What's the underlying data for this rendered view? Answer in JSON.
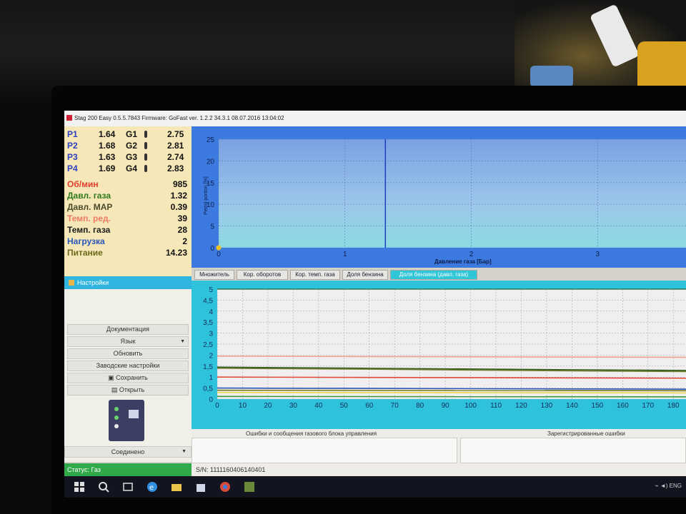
{
  "window": {
    "title": "Stag 200 Easy 0.5.5.7843 Firmware: GoFast  ver. 1.2.2  34.3.1   08.07.2016 13:04:02"
  },
  "injectors": [
    {
      "p_label": "P1",
      "p_value": "1.64",
      "g_label": "G1",
      "g_value": "2.75"
    },
    {
      "p_label": "P2",
      "p_value": "1.68",
      "g_label": "G2",
      "g_value": "2.81"
    },
    {
      "p_label": "P3",
      "p_value": "1.63",
      "g_label": "G3",
      "g_value": "2.74"
    },
    {
      "p_label": "P4",
      "p_value": "1.69",
      "g_label": "G4",
      "g_value": "2.83"
    }
  ],
  "sensors": [
    {
      "label": "Об/мин",
      "value": "985",
      "color": "#e23b2a"
    },
    {
      "label": "Давл. газа",
      "value": "1.32",
      "color": "#2f7a1e"
    },
    {
      "label": "Давл. MAP",
      "value": "0.39",
      "color": "#4a4a2a"
    },
    {
      "label": "Темп. ред.",
      "value": "39",
      "color": "#f07a6a"
    },
    {
      "label": "Темп. газа",
      "value": "28",
      "color": "#1a1a1a"
    },
    {
      "label": "Нагрузка",
      "value": "2",
      "color": "#2a56b8"
    },
    {
      "label": "Питание",
      "value": "14.23",
      "color": "#6a6a1a"
    }
  ],
  "settings_header": "Настройки",
  "menu": {
    "documentation": "Документация",
    "language": "Язык",
    "update": "Обновить",
    "factory": "Заводские настройки",
    "save": "Сохранить",
    "open": "Открыть",
    "connection": "Соединено"
  },
  "tabs": [
    {
      "label": "Множитель",
      "active": false
    },
    {
      "label": "Кор. оборотов",
      "active": false
    },
    {
      "label": "Кор. темп. газа",
      "active": false
    },
    {
      "label": "Доля бензина",
      "active": false
    },
    {
      "label": "Доля бензина (давл. газа)",
      "active": true
    }
  ],
  "messages": {
    "errors_title": "Ошибки и сообщения газового блока управления",
    "registered_title": "Зарегистрированные ошибки"
  },
  "status": {
    "state": "Статус: Газ",
    "serial": "S/N: 1111160406140401"
  },
  "tray": {
    "lang": "ENG"
  },
  "chart_data": [
    {
      "type": "scatter",
      "title": "",
      "ylabel": "Petrol portion [%]",
      "xlabel": "Давление газа [Бар]",
      "ylim": [
        0,
        25
      ],
      "xlim": [
        0,
        3.7
      ],
      "yticks": [
        "0",
        "5",
        "10",
        "15",
        "20",
        "25"
      ],
      "xticks": [
        "0",
        "1",
        "2",
        "3"
      ],
      "points": [
        {
          "x": 0,
          "y": 0
        }
      ],
      "cursor_x": 1.32,
      "grid": true
    },
    {
      "type": "line",
      "title": "",
      "xlabel": "",
      "ylabel": "",
      "ylim": [
        0,
        5
      ],
      "xlim": [
        0,
        185
      ],
      "yticks": [
        "0",
        "0,5",
        "1",
        "1,5",
        "2",
        "2,5",
        "3",
        "3,5",
        "4",
        "4,5",
        "5"
      ],
      "xticks": [
        "0",
        "10",
        "20",
        "30",
        "40",
        "50",
        "60",
        "70",
        "80",
        "90",
        "100",
        "110",
        "120",
        "130",
        "140",
        "150",
        "160",
        "170",
        "180"
      ],
      "grid": true,
      "series": [
        {
          "color": "#f0a090",
          "x": [
            0,
            185
          ],
          "y": [
            1.95,
            1.9
          ]
        },
        {
          "color": "#2a5a1a",
          "x": [
            0,
            60,
            120,
            185
          ],
          "y": [
            1.45,
            1.4,
            1.35,
            1.3
          ]
        },
        {
          "color": "#6f7a2a",
          "x": [
            0,
            60,
            120,
            185
          ],
          "y": [
            1.4,
            1.36,
            1.3,
            1.25
          ]
        },
        {
          "color": "#e24a3a",
          "x": [
            0,
            185
          ],
          "y": [
            1.0,
            0.95
          ]
        },
        {
          "color": "#2a56b8",
          "x": [
            0,
            185
          ],
          "y": [
            0.5,
            0.45
          ]
        },
        {
          "color": "#7a7a1a",
          "x": [
            0,
            185
          ],
          "y": [
            0.4,
            0.38
          ]
        },
        {
          "color": "#e8d84a",
          "x": [
            0,
            185
          ],
          "y": [
            0.3,
            0.28
          ]
        },
        {
          "color": "#3a9a3a",
          "x": [
            0,
            185
          ],
          "y": [
            0.12,
            0.1
          ]
        }
      ]
    }
  ]
}
